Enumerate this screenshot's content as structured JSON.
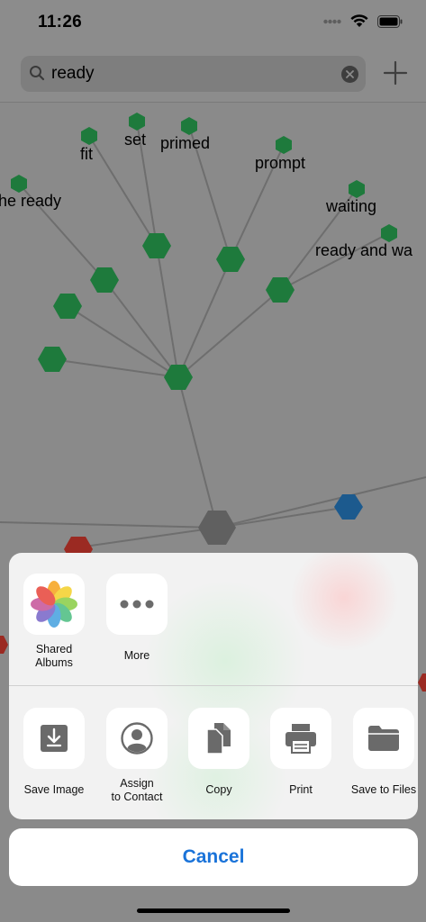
{
  "status_bar": {
    "time": "11:26"
  },
  "search": {
    "query": "ready"
  },
  "graph": {
    "labels": [
      "he ready",
      "fit",
      "set",
      "primed",
      "prompt",
      "waiting",
      "ready and wa"
    ],
    "node_colors": {
      "green": "#1e7a3c",
      "gray": "#606060",
      "blue": "#1c5a8e",
      "red": "#9b2a22"
    }
  },
  "share_sheet": {
    "apps": [
      {
        "label": "Shared\nAlbums",
        "icon": "photos-icon"
      },
      {
        "label": "More",
        "icon": "more-icon"
      }
    ],
    "actions": [
      {
        "label": "Save Image",
        "icon": "save-image-icon"
      },
      {
        "label": "Assign\nto Contact",
        "icon": "contact-icon"
      },
      {
        "label": "Copy",
        "icon": "copy-icon"
      },
      {
        "label": "Print",
        "icon": "print-icon"
      },
      {
        "label": "Save to Files",
        "icon": "folder-icon"
      }
    ],
    "cancel_label": "Cancel"
  }
}
